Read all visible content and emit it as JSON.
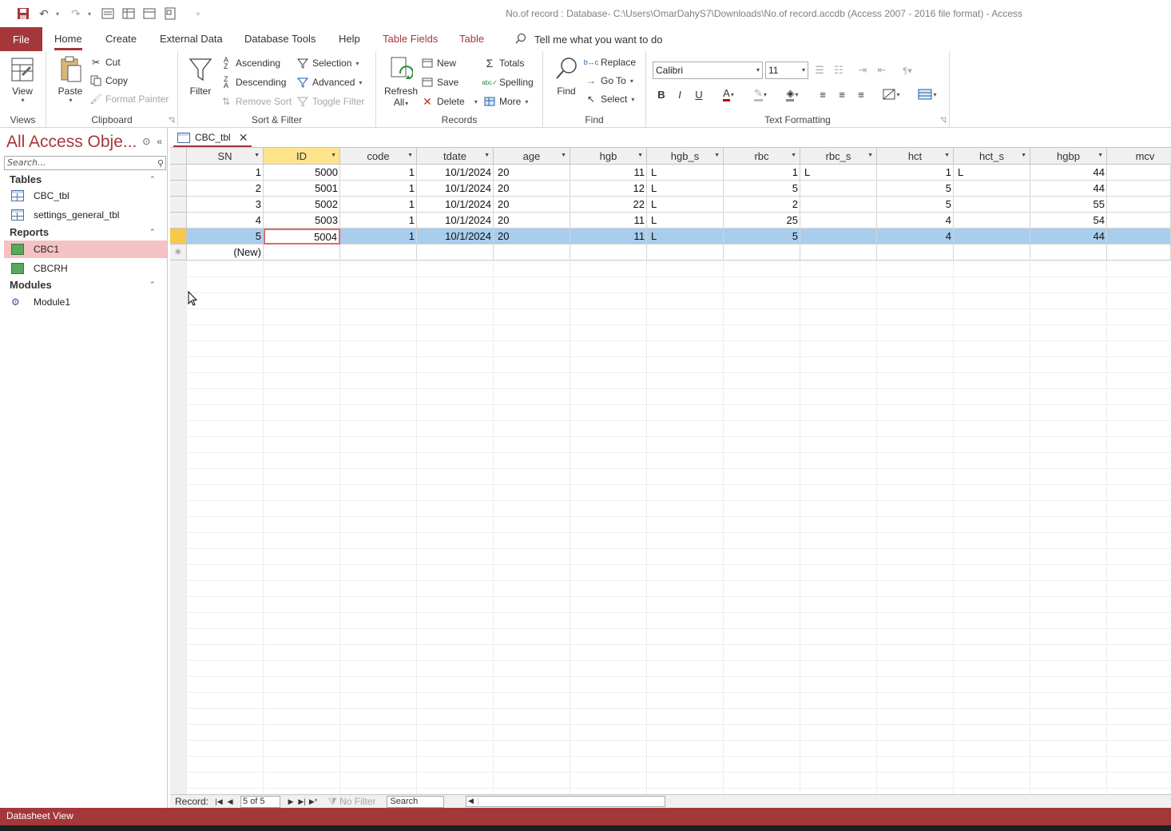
{
  "window": {
    "title": "No.of record : Database- C:\\Users\\OmarDahyS7\\Downloads\\No.of record.accdb (Access 2007 - 2016 file format)  -  Access"
  },
  "tabs": {
    "file": "File",
    "items": [
      "Home",
      "Create",
      "External Data",
      "Database Tools",
      "Help",
      "Table Fields",
      "Table"
    ],
    "tell_me": "Tell me what you want to do"
  },
  "ribbon": {
    "views": {
      "label": "Views",
      "view": "View"
    },
    "clipboard": {
      "label": "Clipboard",
      "paste": "Paste",
      "cut": "Cut",
      "copy": "Copy",
      "format_painter": "Format Painter"
    },
    "sort_filter": {
      "label": "Sort & Filter",
      "filter": "Filter",
      "ascending": "Ascending",
      "descending": "Descending",
      "remove_sort": "Remove Sort",
      "selection": "Selection",
      "advanced": "Advanced",
      "toggle_filter": "Toggle Filter"
    },
    "records": {
      "label": "Records",
      "refresh": "Refresh",
      "refresh_all": "All",
      "new": "New",
      "save": "Save",
      "delete": "Delete",
      "totals": "Totals",
      "spelling": "Spelling",
      "more": "More"
    },
    "find": {
      "label": "Find",
      "find": "Find",
      "replace": "Replace",
      "goto": "Go To",
      "select": "Select"
    },
    "text_formatting": {
      "label": "Text Formatting",
      "font": "Calibri",
      "size": "11",
      "bold": "B",
      "italic": "I",
      "underline": "U"
    }
  },
  "nav": {
    "title": "All Access Obje...",
    "search_placeholder": "Search...",
    "groups": [
      {
        "name": "Tables",
        "items": [
          "CBC_tbl",
          "settings_general_tbl"
        ]
      },
      {
        "name": "Reports",
        "items": [
          "CBC1",
          "CBCRH"
        ]
      },
      {
        "name": "Modules",
        "items": [
          "Module1"
        ]
      }
    ]
  },
  "document": {
    "tab": "CBC_tbl",
    "columns": [
      "SN",
      "ID",
      "code",
      "tdate",
      "age",
      "hgb",
      "hgb_s",
      "rbc",
      "rbc_s",
      "hct",
      "hct_s",
      "hgbp",
      "mcv"
    ],
    "rows": [
      [
        "1",
        "5000",
        "1",
        "10/1/2024",
        "20",
        "11",
        "L",
        "1",
        "L",
        "1",
        "L",
        "44",
        ""
      ],
      [
        "2",
        "5001",
        "1",
        "10/1/2024",
        "20",
        "12",
        "L",
        "5",
        "",
        "5",
        "",
        "44",
        ""
      ],
      [
        "3",
        "5002",
        "1",
        "10/1/2024",
        "20",
        "22",
        "L",
        "2",
        "",
        "5",
        "",
        "55",
        ""
      ],
      [
        "4",
        "5003",
        "1",
        "10/1/2024",
        "20",
        "11",
        "L",
        "25",
        "",
        "4",
        "",
        "54",
        ""
      ],
      [
        "5",
        "5004",
        "1",
        "10/1/2024",
        "20",
        "11",
        "L",
        "5",
        "",
        "4",
        "",
        "44",
        ""
      ]
    ],
    "new_row": "(New)",
    "record_nav": {
      "label": "Record:",
      "position": "5 of 5",
      "no_filter": "No Filter",
      "search": "Search"
    }
  },
  "status": {
    "text": "Datasheet View"
  },
  "colors": {
    "accent": "#a4373a",
    "selected_row": "#a9cdec",
    "active_header": "#fde38a"
  }
}
